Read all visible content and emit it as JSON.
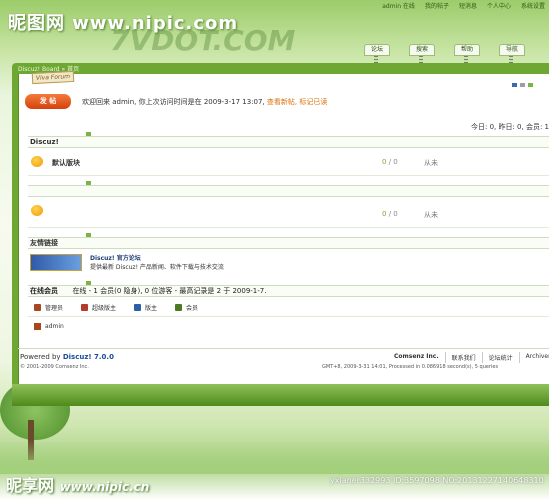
{
  "watermark": {
    "site": "昵图网 www.nipic.com",
    "bottom_site": "昵享网",
    "bottom_url": "www.nipic.cn",
    "bottom_id": "yxianer332993    ID:3597098 NO:20131227140648310"
  },
  "top_nav": {
    "items": [
      "admin 在线",
      "我的帖子",
      "短消息",
      "个人中心",
      "系统设置"
    ]
  },
  "tabs": [
    "论坛",
    "搜索",
    "帮助",
    "导航"
  ],
  "breadcrumb": "Discuz! Board » 首页",
  "stamp": "Viva Forum",
  "post_button": "发 帖",
  "welcome": {
    "text": "欢迎回来 admin, 你上次访问时间是在 2009-3-17 13:07,",
    "new_posts": "查看新帖,",
    "mark_read": "标记已读"
  },
  "stats": "今日: 0, 昨日: 0, 会员: 1",
  "sections": [
    {
      "title": "Discuz!",
      "forums": [
        {
          "name": "默认版块",
          "threads": "0",
          "posts": "0",
          "from": "从未"
        }
      ]
    },
    {
      "title": "",
      "forums": [
        {
          "name": "",
          "threads": "0",
          "posts": "0",
          "from": "从未"
        }
      ]
    }
  ],
  "links": {
    "title": "友情链接",
    "name": "Discuz! 官方论坛",
    "desc": "提供最新 Discuz! 产品新闻、软件下载与技术交流"
  },
  "online": {
    "title": "在线会员",
    "summary": "在线 - 1 会员(0 隐身), 0 位游客 - 最高记录是 2 于 2009-1-7.",
    "legend": [
      {
        "label": "管理员",
        "color": "#a8471b"
      },
      {
        "label": "超级版主",
        "color": "#b53b2a"
      },
      {
        "label": "版主",
        "color": "#2b5fa8"
      },
      {
        "label": "会员",
        "color": "#4b7a22"
      }
    ],
    "user": "admin"
  },
  "footer": {
    "powered_prefix": "Powered by",
    "powered_name": "Discuz! 7.0.0",
    "copyright": "© 2001-2009 Comsenz Inc.",
    "links": [
      "Comsenz Inc.",
      "联系我们",
      "论坛统计",
      "Archiver"
    ],
    "gmt": "GMT+8, 2009-3-31 14:01, Processed in 0.086918 second(s), 5 queries"
  },
  "colors": {
    "frame_green": "#6ea832",
    "accent_orange": "#d4420c"
  }
}
